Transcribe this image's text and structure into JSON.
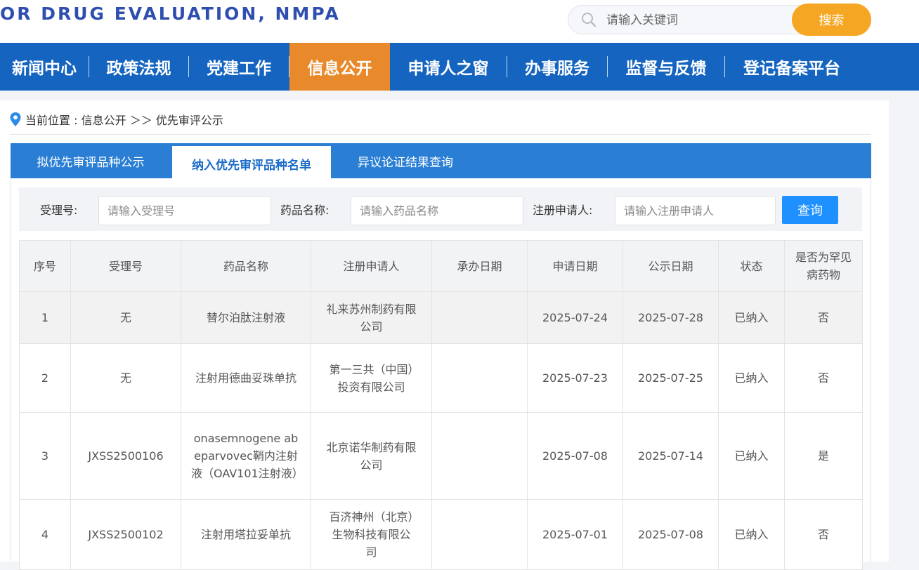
{
  "header": {
    "site_title": "OR DRUG EVALUATION, NMPA",
    "search_placeholder": "请输入关键词",
    "search_button": "搜索"
  },
  "nav": {
    "items": [
      "新闻中心",
      "政策法规",
      "党建工作",
      "信息公开",
      "申请人之窗",
      "办事服务",
      "监督与反馈",
      "登记备案平台"
    ],
    "active_index": 3
  },
  "breadcrumb": {
    "text": "当前位置 : 信息公开 ＞＞ 优先审评公示"
  },
  "tabs": [
    "拟优先审评品种公示",
    "纳入优先审评品种名单",
    "异议论证结果查询"
  ],
  "active_tab": 1,
  "filter": {
    "acceptance_label": "受理号:",
    "acceptance_placeholder": "请输入受理号",
    "drug_label": "药品名称:",
    "drug_placeholder": "请输入药品名称",
    "applicant_label": "注册申请人:",
    "applicant_placeholder": "请输入注册申请人",
    "query_button": "查询"
  },
  "table": {
    "columns": [
      "序号",
      "受理号",
      "药品名称",
      "注册申请人",
      "承办日期",
      "申请日期",
      "公示日期",
      "状态",
      "是否为罕见病药物"
    ],
    "rows": [
      {
        "no": "1",
        "acceptance": "无",
        "drug": "替尔泊肽注射液",
        "applicant": "礼来苏州制药有限公司",
        "undertake": "",
        "apply": "2025-07-24",
        "publicize": "2025-07-28",
        "status": "已纳入",
        "rare": "否"
      },
      {
        "no": "2",
        "acceptance": "无",
        "drug": "注射用德曲妥珠单抗",
        "applicant": "第一三共（中国）投资有限公司",
        "undertake": "",
        "apply": "2025-07-23",
        "publicize": "2025-07-25",
        "status": "已纳入",
        "rare": "否"
      },
      {
        "no": "3",
        "acceptance": "JXSS2500106",
        "drug": "onasemnogene abeparvovec鞘内注射液（OAV101注射液）",
        "applicant": "北京诺华制药有限公司",
        "undertake": "",
        "apply": "2025-07-08",
        "publicize": "2025-07-14",
        "status": "已纳入",
        "rare": "是"
      },
      {
        "no": "4",
        "acceptance": "JXSS2500102",
        "drug": "注射用塔拉妥单抗",
        "applicant": "百济神州（北京）生物科技有限公司",
        "undertake": "",
        "apply": "2025-07-01",
        "publicize": "2025-07-08",
        "status": "已纳入",
        "rare": "否"
      }
    ]
  }
}
